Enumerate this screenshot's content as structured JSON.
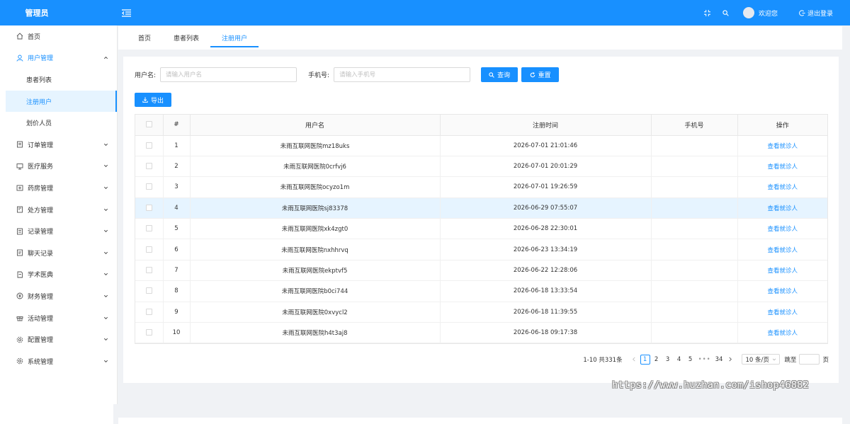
{
  "header": {
    "app_title": "管理员",
    "welcome": "欢迎您",
    "logout": "退出登录"
  },
  "sidebar": {
    "items": [
      {
        "label": "首页",
        "icon": "home-icon"
      },
      {
        "label": "用户管理",
        "icon": "user-icon",
        "open": true,
        "children": [
          {
            "label": "患者列表"
          },
          {
            "label": "注册用户",
            "active": true
          },
          {
            "label": "划价人员"
          }
        ]
      },
      {
        "label": "订单管理",
        "icon": "order-icon"
      },
      {
        "label": "医疗服务",
        "icon": "monitor-icon"
      },
      {
        "label": "药房管理",
        "icon": "pharmacy-icon"
      },
      {
        "label": "处方管理",
        "icon": "prescription-icon"
      },
      {
        "label": "记录管理",
        "icon": "record-icon"
      },
      {
        "label": "聊天记录",
        "icon": "chat-icon"
      },
      {
        "label": "学术医典",
        "icon": "book-icon"
      },
      {
        "label": "财务管理",
        "icon": "finance-icon"
      },
      {
        "label": "活动管理",
        "icon": "gift-icon"
      },
      {
        "label": "配置管理",
        "icon": "config-icon"
      },
      {
        "label": "系统管理",
        "icon": "system-icon"
      }
    ]
  },
  "tabs": [
    {
      "label": "首页"
    },
    {
      "label": "患者列表"
    },
    {
      "label": "注册用户",
      "active": true
    }
  ],
  "filters": {
    "username_label": "用户名:",
    "username_placeholder": "请输入用户名",
    "phone_label": "手机号:",
    "phone_placeholder": "请输入手机号",
    "query_button": "查询",
    "reset_button": "重置",
    "export_button": "导出"
  },
  "table": {
    "columns": [
      "#",
      "用户名",
      "注册时间",
      "手机号",
      "操作"
    ],
    "rows": [
      {
        "no": "1",
        "username": "未雨互联网医院mz18uks",
        "time": "2026-07-01 21:01:46",
        "phone": "",
        "action": "查看就诊人"
      },
      {
        "no": "2",
        "username": "未雨互联网医院0crfvj6",
        "time": "2026-07-01 20:01:29",
        "phone": "",
        "action": "查看就诊人"
      },
      {
        "no": "3",
        "username": "未雨互联网医院ocyzo1m",
        "time": "2026-07-01 19:26:59",
        "phone": "",
        "action": "查看就诊人"
      },
      {
        "no": "4",
        "username": "未雨互联网医院sj83378",
        "time": "2026-06-29 07:55:07",
        "phone": "",
        "action": "查看就诊人",
        "highlight": true
      },
      {
        "no": "5",
        "username": "未雨互联网医院xk4zgt0",
        "time": "2026-06-28 22:30:01",
        "phone": "",
        "action": "查看就诊人"
      },
      {
        "no": "6",
        "username": "未雨互联网医院nxhhrvq",
        "time": "2026-06-23 13:34:19",
        "phone": "",
        "action": "查看就诊人"
      },
      {
        "no": "7",
        "username": "未雨互联网医院ekptvf5",
        "time": "2026-06-22 12:28:06",
        "phone": "",
        "action": "查看就诊人"
      },
      {
        "no": "8",
        "username": "未雨互联网医院b0ci744",
        "time": "2026-06-18 13:33:54",
        "phone": "",
        "action": "查看就诊人"
      },
      {
        "no": "9",
        "username": "未雨互联网医院0xvycl2",
        "time": "2026-06-18 11:39:55",
        "phone": "",
        "action": "查看就诊人"
      },
      {
        "no": "10",
        "username": "未雨互联网医院h4t3aj8",
        "time": "2026-06-18 09:17:38",
        "phone": "",
        "action": "查看就诊人"
      }
    ]
  },
  "pagination": {
    "total_text": "1-10 共331条",
    "pages": [
      "1",
      "2",
      "3",
      "4",
      "5"
    ],
    "ellipsis": "•••",
    "last_page": "34",
    "current": "1",
    "page_size": "10 条/页",
    "jump_label": "跳至",
    "page_suffix": "页"
  },
  "watermark": "https://www.huzhan.com/ishop46882",
  "colors": {
    "primary": "#1890ff",
    "highlight_row": "#e6f4ff"
  }
}
